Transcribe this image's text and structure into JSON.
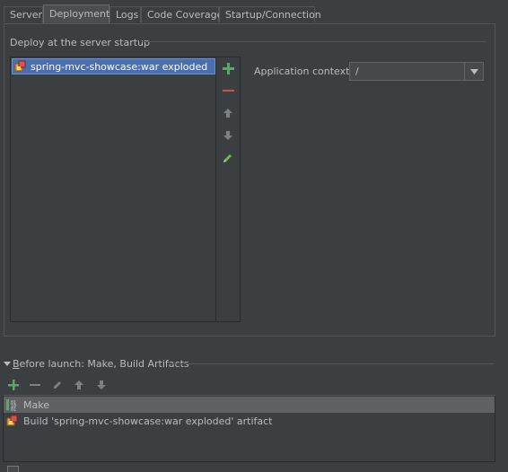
{
  "tabs": [
    {
      "label": "Server",
      "active": false
    },
    {
      "label": "Deployment",
      "active": true
    },
    {
      "label": "Logs",
      "active": false
    },
    {
      "label": "Code Coverage",
      "active": false
    },
    {
      "label": "Startup/Connection",
      "active": false
    }
  ],
  "deploy": {
    "group_title": "Deploy at the server startup",
    "items": [
      {
        "label": "spring-mvc-showcase:war exploded",
        "icon": "artifact-icon",
        "selected": true
      }
    ],
    "toolbar": [
      "add-icon",
      "remove-icon",
      "move-up-icon",
      "move-down-icon",
      "edit-icon"
    ]
  },
  "context": {
    "label": "Application context:",
    "value": "/"
  },
  "before_launch": {
    "title_prefix": "B",
    "title_rest": "efore launch: Make, Build Artifacts",
    "items": [
      {
        "label": "Make",
        "icon": "make-icon",
        "selected": true
      },
      {
        "label": "Build 'spring-mvc-showcase:war exploded' artifact",
        "icon": "artifact-icon",
        "selected": false
      }
    ]
  },
  "colors": {
    "background": "#3c3f41",
    "selection": "#4b6eaf",
    "add_green": "#59a869",
    "remove_red": "#c75450"
  }
}
